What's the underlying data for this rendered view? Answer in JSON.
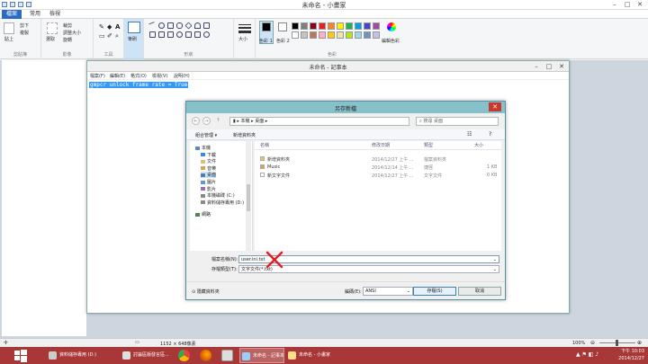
{
  "paint": {
    "title": "未命名 - 小畫家",
    "tabs": [
      "檔案",
      "常用",
      "檢視"
    ],
    "ribbon": {
      "paste": "貼上",
      "cut": "剪下",
      "copy": "複製",
      "select": "選取",
      "crop": "裁剪",
      "resize": "調整大小",
      "rotate": "旋轉",
      "brush": "筆刷",
      "size": "大小",
      "color1": "色彩 1",
      "color2": "色彩 2",
      "edit_colors": "編輯色彩",
      "groups": [
        "剪貼簿",
        "影像",
        "工具",
        "形狀",
        "色彩"
      ]
    },
    "status": {
      "dimensions": "1152 × 648像素",
      "zoom": "100%"
    }
  },
  "notepad": {
    "title": "未命名 - 記事本",
    "menu": [
      "檔案(F)",
      "編輯(E)",
      "格式(O)",
      "檢視(V)",
      "說明(H)"
    ],
    "text": "gmpcr unlock frame rate = True"
  },
  "dialog": {
    "title": "另存新檔",
    "address": [
      "本機",
      "桌面"
    ],
    "search_placeholder": "搜尋 桌面",
    "toolbar": {
      "organize": "組合管理 ▾",
      "new_folder": "新增資料夾"
    },
    "nav": [
      {
        "label": "本機",
        "indent": 0
      },
      {
        "label": "下載",
        "indent": 1
      },
      {
        "label": "文件",
        "indent": 1
      },
      {
        "label": "音樂",
        "indent": 1
      },
      {
        "label": "桌面",
        "indent": 1,
        "selected": true
      },
      {
        "label": "圖片",
        "indent": 1
      },
      {
        "label": "影片",
        "indent": 1
      },
      {
        "label": "本機磁碟 (C:)",
        "indent": 1
      },
      {
        "label": "資料儲存專用 (D:)",
        "indent": 1
      },
      {
        "label": "網路",
        "indent": 0
      }
    ],
    "columns": [
      "名稱",
      "修改日期",
      "類型",
      "大小"
    ],
    "files": [
      {
        "name": "新增資料夾",
        "date": "2014/12/27 上午 ...",
        "type": "檔案資料夾",
        "size": ""
      },
      {
        "name": "Music",
        "date": "2014/12/14 上午 ...",
        "type": "捷徑",
        "size": "1 KB"
      },
      {
        "name": "新文字文件",
        "date": "2014/12/27 上午 ...",
        "type": "文字文件",
        "size": "0 KB"
      }
    ],
    "filename_label": "檔案名稱(N):",
    "filename": "user.ini.txt",
    "filetype_label": "存檔類型(T):",
    "filetype": "文字文件(*.txt)",
    "hide_folders": "隱藏資料夾",
    "encoding_label": "編碼(E):",
    "encoding": "ANSI",
    "save": "存檔(S)",
    "cancel": "取消"
  },
  "taskbar": {
    "items": [
      {
        "label": "資料儲存專用 (D:)"
      },
      {
        "label": "討論區版發言區..."
      },
      {
        "label": "未命名 - 記事本"
      },
      {
        "label": "未命名 - 小畫家"
      }
    ],
    "time": "下午 10:03",
    "date": "2014/12/27"
  },
  "colors": {
    "title_teal": "#86c0c8",
    "taskbar": "#a83838",
    "selection": "#3399ff",
    "close_red": "#c7382d",
    "x_mark": "#e02020",
    "palette": [
      "#000000",
      "#7f7f7f",
      "#880015",
      "#ed1c24",
      "#ff7f27",
      "#fff200",
      "#22b14c",
      "#00a2e8",
      "#3f48cc",
      "#a349a4",
      "#ffffff",
      "#c3c3c3",
      "#b97a57",
      "#ffaec9",
      "#ffc90e",
      "#efe4b0",
      "#b5e61d",
      "#99d9ea",
      "#7092be",
      "#c8bfe7"
    ]
  }
}
